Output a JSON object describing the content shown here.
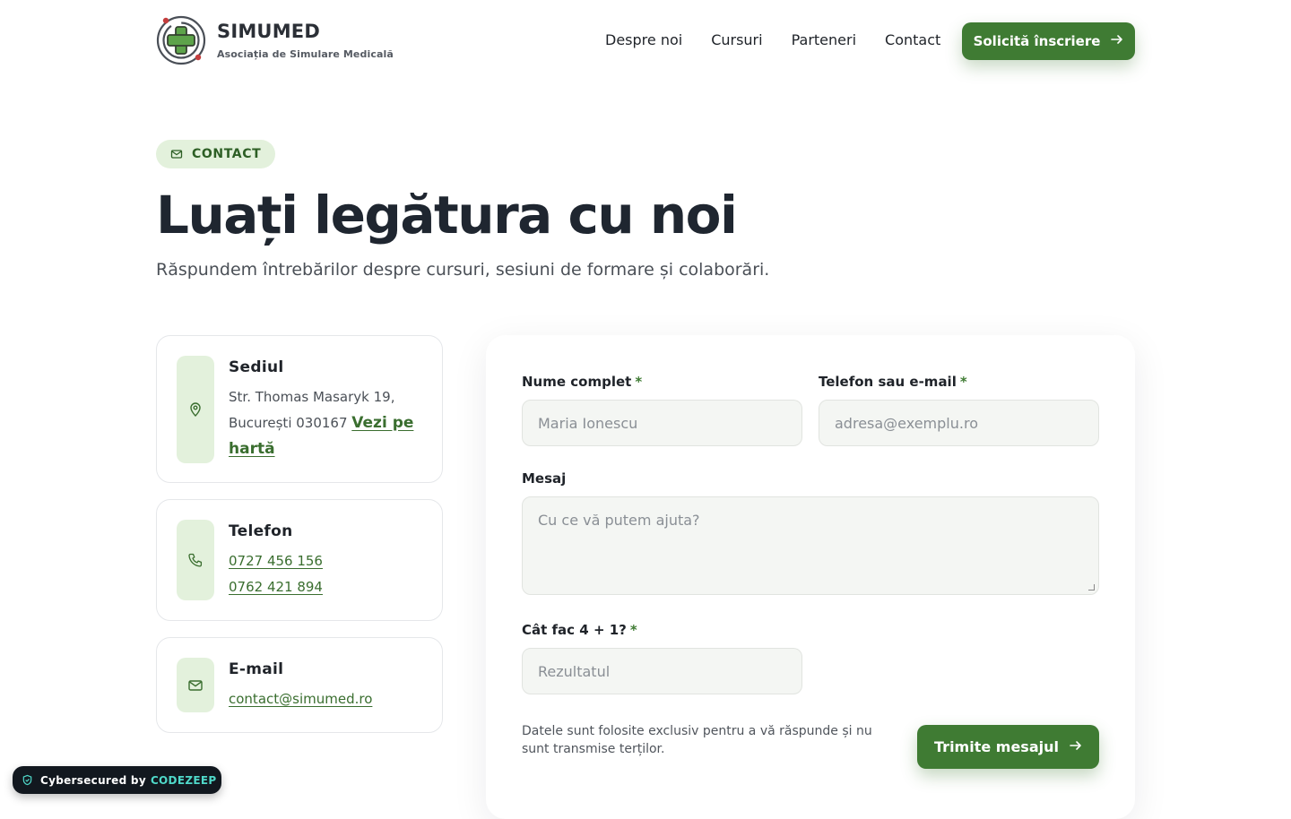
{
  "header": {
    "logo_title": "SIMUMED",
    "logo_subtitle": "Asociația de Simulare Medicală",
    "nav": [
      "Despre noi",
      "Cursuri",
      "Parteneri",
      "Contact"
    ],
    "cta_label": "Solicită înscriere",
    "cta_icon": "arrow-right-icon"
  },
  "hero": {
    "badge": "CONTACT",
    "badge_icon": "mail-icon",
    "title": "Luați legătura cu noi",
    "subtitle": "Răspundem întrebărilor despre cursuri, sesiuni de formare și colaborări."
  },
  "cards": {
    "office": {
      "title": "Sediul",
      "address_line1": "Str. Thomas Masaryk 19,",
      "address_line2": "București 030167",
      "map_link": "Vezi pe hartă",
      "icon": "location-pin-icon"
    },
    "phone": {
      "title": "Telefon",
      "numbers": [
        "0727 456 156",
        "0762 421 894"
      ],
      "icon": "phone-icon"
    },
    "email": {
      "title": "E-mail",
      "address": "contact@simumed.ro",
      "icon": "mail-icon"
    }
  },
  "form": {
    "name_label": "Nume complet",
    "name_placeholder": "Maria Ionescu",
    "contact_label": "Telefon sau e-mail",
    "contact_placeholder": "adresa@exemplu.ro",
    "message_label": "Mesaj",
    "message_placeholder": "Cu ce vă putem ajuta?",
    "captcha_label": "Cât fac 4 + 1?",
    "captcha_placeholder": "Rezultatul",
    "required_mark": "*",
    "note": "Datele sunt folosite exclusiv pentru a vă răspunde și nu sunt transmise terților.",
    "submit_label": "Trimite mesajul"
  },
  "secured": {
    "prefix": "Cybersecured by",
    "brand": "CODEZEEP"
  },
  "colors": {
    "accent": "#3f7b33",
    "accent_light": "#e3f1dc",
    "text_dark": "#1f2630"
  }
}
